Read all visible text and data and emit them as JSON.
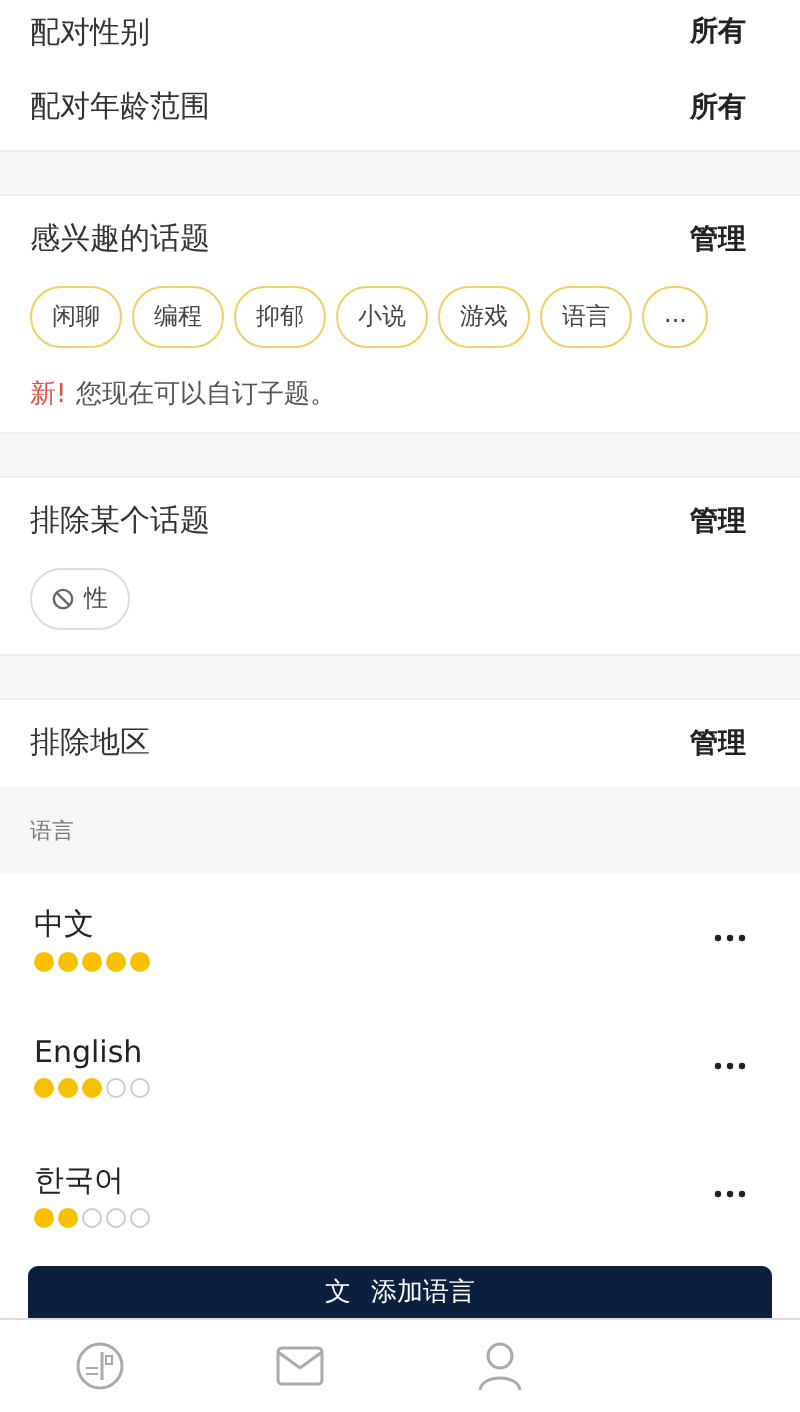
{
  "settings": [
    {
      "label": "配对性别",
      "value": "所有"
    },
    {
      "label": "配对年龄范围",
      "value": "所有"
    }
  ],
  "interests": {
    "title": "感兴趣的话题",
    "action": "管理",
    "tags": [
      "闲聊",
      "编程",
      "抑郁",
      "小说",
      "游戏",
      "语言",
      "..."
    ],
    "notice_new": "新!",
    "notice": "您现在可以自订子题。"
  },
  "excluded_topics": {
    "title": "排除某个话题",
    "action": "管理",
    "tags": [
      "性"
    ]
  },
  "excluded_regions": {
    "title": "排除地区",
    "action": "管理"
  },
  "languages_header": "语言",
  "languages": [
    {
      "name": "中文",
      "stars": 5
    },
    {
      "name": "English",
      "stars": 3
    },
    {
      "name": "한국어",
      "stars": 2
    }
  ],
  "add_button": {
    "icon": "文",
    "label": "添加语言"
  }
}
